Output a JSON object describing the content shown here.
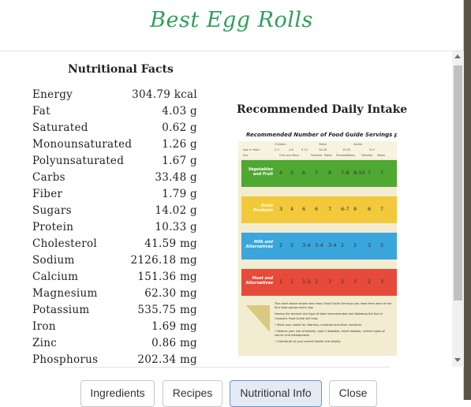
{
  "dialog": {
    "title": "Best Egg Rolls"
  },
  "nutrition": {
    "heading": "Nutritional Facts",
    "rows": [
      {
        "name": "Energy",
        "value": "304.79 kcal"
      },
      {
        "name": "Fat",
        "value": "4.03 g"
      },
      {
        "name": "Saturated",
        "value": "0.62 g"
      },
      {
        "name": "Monounsaturated",
        "value": "1.26 g"
      },
      {
        "name": "Polyunsaturated",
        "value": "1.67 g"
      },
      {
        "name": "Carbs",
        "value": "33.48 g"
      },
      {
        "name": "Fiber",
        "value": "1.79 g"
      },
      {
        "name": "Sugars",
        "value": "14.02 g"
      },
      {
        "name": "Protein",
        "value": "10.33 g"
      },
      {
        "name": "Cholesterol",
        "value": "41.59 mg"
      },
      {
        "name": "Sodium",
        "value": "2126.18 mg"
      },
      {
        "name": "Calcium",
        "value": "151.36 mg"
      },
      {
        "name": "Magnesium",
        "value": "62.30 mg"
      },
      {
        "name": "Potassium",
        "value": "535.75 mg"
      },
      {
        "name": "Iron",
        "value": "1.69 mg"
      },
      {
        "name": "Zinc",
        "value": "0.86 mg"
      },
      {
        "name": "Phosphorus",
        "value": "202.34 mg"
      }
    ]
  },
  "daily_intake": {
    "heading": "Recommended Daily Intake",
    "guide": {
      "title": "Recommended Number of Food Guide Servings per Day",
      "age_groups": [
        "Children",
        "Teens",
        "Adults"
      ],
      "row_labels": {
        "age": "Age in Years",
        "sex": "Sex"
      },
      "ages": [
        "2-3",
        "4-8",
        "9-13",
        "14-18",
        "19-50",
        "51+"
      ],
      "sexes": [
        "Girls and Boys",
        "Females",
        "Males",
        "Females",
        "Males",
        "Females",
        "Males"
      ],
      "groups": [
        {
          "name": "Vegetables and Fruit",
          "color": "#4fa832",
          "values": [
            "4",
            "5",
            "6",
            "7",
            "8",
            "7-8",
            "8-10",
            "7",
            "7"
          ]
        },
        {
          "name": "Grain Products",
          "color": "#f2c93a",
          "values": [
            "3",
            "4",
            "6",
            "6",
            "7",
            "6-7",
            "8",
            "6",
            "7"
          ]
        },
        {
          "name": "Milk and Alternatives",
          "color": "#3aa6dc",
          "values": [
            "2",
            "2",
            "3-4",
            "3-4",
            "3-4",
            "2",
            "2",
            "3",
            "3"
          ]
        },
        {
          "name": "Meat and Alternatives",
          "color": "#e64a3a",
          "values": [
            "1",
            "1",
            "1-2",
            "2",
            "3",
            "2",
            "3",
            "2",
            "3"
          ]
        }
      ],
      "notes": [
        "The chart above shows how many Food Guide Servings you need from each of the four food groups every day.",
        "Having the amount and type of food recommended and following the tips in Canada's Food Guide will help:",
        "• Meet your needs for vitamins, minerals and other nutrients.",
        "• Reduce your risk of obesity, type 2 diabetes, heart disease, certain types of cancer and osteoporosis.",
        "• Contribute to your overall health and vitality."
      ]
    }
  },
  "footer": {
    "buttons": [
      {
        "label": "Ingredients",
        "active": false
      },
      {
        "label": "Recipes",
        "active": false
      },
      {
        "label": "Nutritional Info",
        "active": true
      },
      {
        "label": "Close",
        "active": false
      }
    ]
  },
  "colors": {
    "title": "#2e9f5a",
    "active_button_bg": "#e4ebf5",
    "active_button_border": "#6f95c4"
  }
}
